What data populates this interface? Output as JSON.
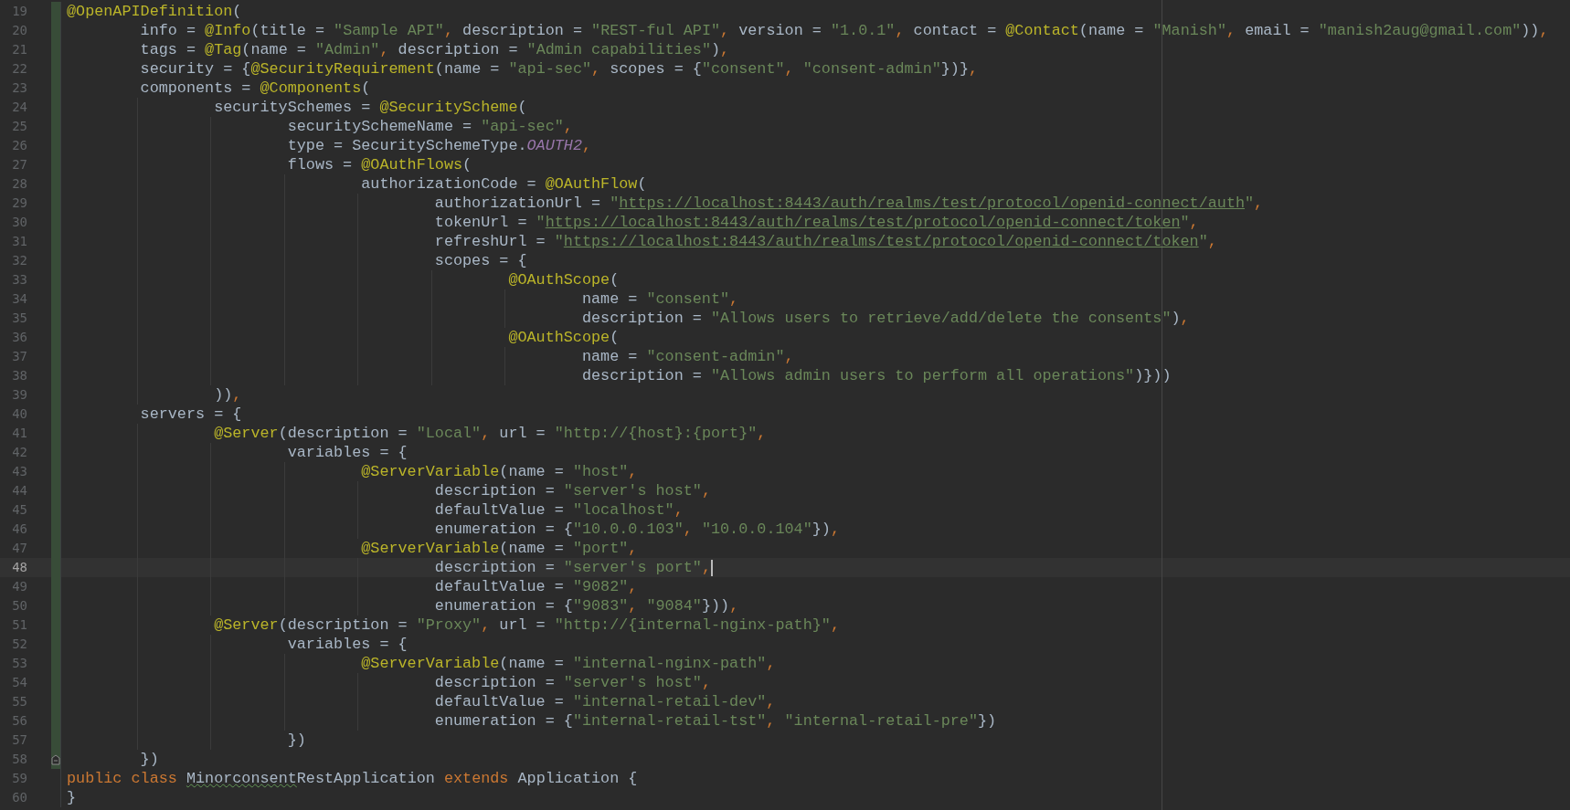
{
  "editor": {
    "lines": [
      {
        "number": "19",
        "changed": true,
        "current": false,
        "fold": false,
        "tokens": [
          {
            "kind": "annotation",
            "text": "@OpenAPIDefinition"
          },
          {
            "kind": "plain",
            "text": "("
          }
        ]
      },
      {
        "number": "20",
        "changed": true,
        "current": false,
        "fold": false,
        "tokens": [
          {
            "kind": "plain",
            "text": "        info = "
          },
          {
            "kind": "annotation",
            "text": "@Info"
          },
          {
            "kind": "plain",
            "text": "(title = "
          },
          {
            "kind": "string",
            "text": "\"Sample API\""
          },
          {
            "kind": "keyword",
            "text": ","
          },
          {
            "kind": "plain",
            "text": " description = "
          },
          {
            "kind": "string",
            "text": "\"REST-ful API\""
          },
          {
            "kind": "keyword",
            "text": ","
          },
          {
            "kind": "plain",
            "text": " version = "
          },
          {
            "kind": "string",
            "text": "\"1.0.1\""
          },
          {
            "kind": "keyword",
            "text": ","
          },
          {
            "kind": "plain",
            "text": " contact = "
          },
          {
            "kind": "annotation",
            "text": "@Contact"
          },
          {
            "kind": "plain",
            "text": "(name = "
          },
          {
            "kind": "string",
            "text": "\"Manish\""
          },
          {
            "kind": "keyword",
            "text": ","
          },
          {
            "kind": "plain",
            "text": " email = "
          },
          {
            "kind": "string",
            "text": "\"manish2aug@gmail.com\""
          },
          {
            "kind": "plain",
            "text": "))"
          },
          {
            "kind": "keyword",
            "text": ","
          }
        ]
      },
      {
        "number": "21",
        "changed": true,
        "current": false,
        "fold": false,
        "tokens": [
          {
            "kind": "plain",
            "text": "        tags = "
          },
          {
            "kind": "annotation",
            "text": "@Tag"
          },
          {
            "kind": "plain",
            "text": "(name = "
          },
          {
            "kind": "string",
            "text": "\"Admin\""
          },
          {
            "kind": "keyword",
            "text": ","
          },
          {
            "kind": "plain",
            "text": " description = "
          },
          {
            "kind": "string",
            "text": "\"Admin capabilities\""
          },
          {
            "kind": "plain",
            "text": ")"
          },
          {
            "kind": "keyword",
            "text": ","
          }
        ]
      },
      {
        "number": "22",
        "changed": true,
        "current": false,
        "fold": false,
        "tokens": [
          {
            "kind": "plain",
            "text": "        security = {"
          },
          {
            "kind": "annotation",
            "text": "@SecurityRequirement"
          },
          {
            "kind": "plain",
            "text": "(name = "
          },
          {
            "kind": "string",
            "text": "\"api-sec\""
          },
          {
            "kind": "keyword",
            "text": ","
          },
          {
            "kind": "plain",
            "text": " scopes = {"
          },
          {
            "kind": "string",
            "text": "\"consent\""
          },
          {
            "kind": "keyword",
            "text": ", "
          },
          {
            "kind": "string",
            "text": "\"consent-admin\""
          },
          {
            "kind": "plain",
            "text": "})}"
          },
          {
            "kind": "keyword",
            "text": ","
          }
        ]
      },
      {
        "number": "23",
        "changed": true,
        "current": false,
        "fold": false,
        "tokens": [
          {
            "kind": "plain",
            "text": "        components = "
          },
          {
            "kind": "annotation",
            "text": "@Components"
          },
          {
            "kind": "plain",
            "text": "("
          }
        ]
      },
      {
        "number": "24",
        "changed": true,
        "current": false,
        "fold": false,
        "tokens": [
          {
            "kind": "plain",
            "text": "                securitySchemes = "
          },
          {
            "kind": "annotation",
            "text": "@SecurityScheme"
          },
          {
            "kind": "plain",
            "text": "("
          }
        ]
      },
      {
        "number": "25",
        "changed": true,
        "current": false,
        "fold": false,
        "tokens": [
          {
            "kind": "plain",
            "text": "                        securitySchemeName = "
          },
          {
            "kind": "string",
            "text": "\"api-sec\""
          },
          {
            "kind": "keyword",
            "text": ","
          }
        ]
      },
      {
        "number": "26",
        "changed": true,
        "current": false,
        "fold": false,
        "tokens": [
          {
            "kind": "plain",
            "text": "                        type = SecuritySchemeType."
          },
          {
            "kind": "constant",
            "text": "OAUTH2"
          },
          {
            "kind": "keyword",
            "text": ","
          }
        ]
      },
      {
        "number": "27",
        "changed": true,
        "current": false,
        "fold": false,
        "tokens": [
          {
            "kind": "plain",
            "text": "                        flows = "
          },
          {
            "kind": "annotation",
            "text": "@OAuthFlows"
          },
          {
            "kind": "plain",
            "text": "("
          }
        ]
      },
      {
        "number": "28",
        "changed": true,
        "current": false,
        "fold": false,
        "tokens": [
          {
            "kind": "plain",
            "text": "                                authorizationCode = "
          },
          {
            "kind": "annotation",
            "text": "@OAuthFlow"
          },
          {
            "kind": "plain",
            "text": "("
          }
        ]
      },
      {
        "number": "29",
        "changed": true,
        "current": false,
        "fold": false,
        "tokens": [
          {
            "kind": "plain",
            "text": "                                        authorizationUrl = "
          },
          {
            "kind": "string",
            "text": "\""
          },
          {
            "kind": "url",
            "text": "https://localhost:8443/auth/realms/test/protocol/openid-connect/auth"
          },
          {
            "kind": "string",
            "text": "\""
          },
          {
            "kind": "keyword",
            "text": ","
          }
        ]
      },
      {
        "number": "30",
        "changed": true,
        "current": false,
        "fold": false,
        "tokens": [
          {
            "kind": "plain",
            "text": "                                        tokenUrl = "
          },
          {
            "kind": "string",
            "text": "\""
          },
          {
            "kind": "url",
            "text": "https://localhost:8443/auth/realms/test/protocol/openid-connect/token"
          },
          {
            "kind": "string",
            "text": "\""
          },
          {
            "kind": "keyword",
            "text": ","
          }
        ]
      },
      {
        "number": "31",
        "changed": true,
        "current": false,
        "fold": false,
        "tokens": [
          {
            "kind": "plain",
            "text": "                                        refreshUrl = "
          },
          {
            "kind": "string",
            "text": "\""
          },
          {
            "kind": "url",
            "text": "https://localhost:8443/auth/realms/test/protocol/openid-connect/token"
          },
          {
            "kind": "string",
            "text": "\""
          },
          {
            "kind": "keyword",
            "text": ","
          }
        ]
      },
      {
        "number": "32",
        "changed": true,
        "current": false,
        "fold": false,
        "tokens": [
          {
            "kind": "plain",
            "text": "                                        scopes = {"
          }
        ]
      },
      {
        "number": "33",
        "changed": true,
        "current": false,
        "fold": false,
        "tokens": [
          {
            "kind": "annotation",
            "text": "                                                @OAuthScope"
          },
          {
            "kind": "plain",
            "text": "("
          }
        ]
      },
      {
        "number": "34",
        "changed": true,
        "current": false,
        "fold": false,
        "tokens": [
          {
            "kind": "plain",
            "text": "                                                        name = "
          },
          {
            "kind": "string",
            "text": "\"consent\""
          },
          {
            "kind": "keyword",
            "text": ","
          }
        ]
      },
      {
        "number": "35",
        "changed": true,
        "current": false,
        "fold": false,
        "tokens": [
          {
            "kind": "plain",
            "text": "                                                        description = "
          },
          {
            "kind": "string",
            "text": "\"Allows users to retrieve/add/delete the consents\""
          },
          {
            "kind": "plain",
            "text": ")"
          },
          {
            "kind": "keyword",
            "text": ","
          }
        ]
      },
      {
        "number": "36",
        "changed": true,
        "current": false,
        "fold": false,
        "tokens": [
          {
            "kind": "annotation",
            "text": "                                                @OAuthScope"
          },
          {
            "kind": "plain",
            "text": "("
          }
        ]
      },
      {
        "number": "37",
        "changed": true,
        "current": false,
        "fold": false,
        "tokens": [
          {
            "kind": "plain",
            "text": "                                                        name = "
          },
          {
            "kind": "string",
            "text": "\"consent-admin\""
          },
          {
            "kind": "keyword",
            "text": ","
          }
        ]
      },
      {
        "number": "38",
        "changed": true,
        "current": false,
        "fold": false,
        "tokens": [
          {
            "kind": "plain",
            "text": "                                                        description = "
          },
          {
            "kind": "string",
            "text": "\"Allows admin users to perform all operations\""
          },
          {
            "kind": "plain",
            "text": ")}))"
          }
        ]
      },
      {
        "number": "39",
        "changed": true,
        "current": false,
        "fold": false,
        "tokens": [
          {
            "kind": "plain",
            "text": "                ))"
          },
          {
            "kind": "keyword",
            "text": ","
          }
        ]
      },
      {
        "number": "40",
        "changed": true,
        "current": false,
        "fold": false,
        "tokens": [
          {
            "kind": "plain",
            "text": "        servers = {"
          }
        ]
      },
      {
        "number": "41",
        "changed": true,
        "current": false,
        "fold": false,
        "tokens": [
          {
            "kind": "annotation",
            "text": "                @Server"
          },
          {
            "kind": "plain",
            "text": "(description = "
          },
          {
            "kind": "string",
            "text": "\"Local\""
          },
          {
            "kind": "keyword",
            "text": ","
          },
          {
            "kind": "plain",
            "text": " url = "
          },
          {
            "kind": "string",
            "text": "\"http://{host}:{port}\""
          },
          {
            "kind": "keyword",
            "text": ","
          }
        ]
      },
      {
        "number": "42",
        "changed": true,
        "current": false,
        "fold": false,
        "tokens": [
          {
            "kind": "plain",
            "text": "                        variables = {"
          }
        ]
      },
      {
        "number": "43",
        "changed": true,
        "current": false,
        "fold": false,
        "tokens": [
          {
            "kind": "annotation",
            "text": "                                @ServerVariable"
          },
          {
            "kind": "plain",
            "text": "(name = "
          },
          {
            "kind": "string",
            "text": "\"host\""
          },
          {
            "kind": "keyword",
            "text": ","
          }
        ]
      },
      {
        "number": "44",
        "changed": true,
        "current": false,
        "fold": false,
        "tokens": [
          {
            "kind": "plain",
            "text": "                                        description = "
          },
          {
            "kind": "string",
            "text": "\"server's host\""
          },
          {
            "kind": "keyword",
            "text": ","
          }
        ]
      },
      {
        "number": "45",
        "changed": true,
        "current": false,
        "fold": false,
        "tokens": [
          {
            "kind": "plain",
            "text": "                                        defaultValue = "
          },
          {
            "kind": "string",
            "text": "\"localhost\""
          },
          {
            "kind": "keyword",
            "text": ","
          }
        ]
      },
      {
        "number": "46",
        "changed": true,
        "current": false,
        "fold": false,
        "tokens": [
          {
            "kind": "plain",
            "text": "                                        enumeration = {"
          },
          {
            "kind": "string",
            "text": "\"10.0.0.103\""
          },
          {
            "kind": "keyword",
            "text": ", "
          },
          {
            "kind": "string",
            "text": "\"10.0.0.104\""
          },
          {
            "kind": "plain",
            "text": "})"
          },
          {
            "kind": "keyword",
            "text": ","
          }
        ]
      },
      {
        "number": "47",
        "changed": true,
        "current": false,
        "fold": false,
        "tokens": [
          {
            "kind": "annotation",
            "text": "                                @ServerVariable"
          },
          {
            "kind": "plain",
            "text": "(name = "
          },
          {
            "kind": "string",
            "text": "\"port\""
          },
          {
            "kind": "keyword",
            "text": ","
          }
        ]
      },
      {
        "number": "48",
        "changed": true,
        "current": true,
        "fold": false,
        "tokens": [
          {
            "kind": "plain",
            "text": "                                        description = "
          },
          {
            "kind": "string",
            "text": "\"server's port\""
          },
          {
            "kind": "keyword",
            "text": ","
          }
        ]
      },
      {
        "number": "49",
        "changed": true,
        "current": false,
        "fold": false,
        "tokens": [
          {
            "kind": "plain",
            "text": "                                        defaultValue = "
          },
          {
            "kind": "string",
            "text": "\"9082\""
          },
          {
            "kind": "keyword",
            "text": ","
          }
        ]
      },
      {
        "number": "50",
        "changed": true,
        "current": false,
        "fold": false,
        "tokens": [
          {
            "kind": "plain",
            "text": "                                        enumeration = {"
          },
          {
            "kind": "string",
            "text": "\"9083\""
          },
          {
            "kind": "keyword",
            "text": ", "
          },
          {
            "kind": "string",
            "text": "\"9084\""
          },
          {
            "kind": "plain",
            "text": "}))"
          },
          {
            "kind": "keyword",
            "text": ","
          }
        ]
      },
      {
        "number": "51",
        "changed": true,
        "current": false,
        "fold": false,
        "tokens": [
          {
            "kind": "annotation",
            "text": "                @Server"
          },
          {
            "kind": "plain",
            "text": "(description = "
          },
          {
            "kind": "string",
            "text": "\"Proxy\""
          },
          {
            "kind": "keyword",
            "text": ","
          },
          {
            "kind": "plain",
            "text": " url = "
          },
          {
            "kind": "string",
            "text": "\"http://{internal-nginx-path}\""
          },
          {
            "kind": "keyword",
            "text": ","
          }
        ]
      },
      {
        "number": "52",
        "changed": true,
        "current": false,
        "fold": false,
        "tokens": [
          {
            "kind": "plain",
            "text": "                        variables = {"
          }
        ]
      },
      {
        "number": "53",
        "changed": true,
        "current": false,
        "fold": false,
        "tokens": [
          {
            "kind": "annotation",
            "text": "                                @ServerVariable"
          },
          {
            "kind": "plain",
            "text": "(name = "
          },
          {
            "kind": "string",
            "text": "\"internal-nginx-path\""
          },
          {
            "kind": "keyword",
            "text": ","
          }
        ]
      },
      {
        "number": "54",
        "changed": true,
        "current": false,
        "fold": false,
        "tokens": [
          {
            "kind": "plain",
            "text": "                                        description = "
          },
          {
            "kind": "string",
            "text": "\"server's host\""
          },
          {
            "kind": "keyword",
            "text": ","
          }
        ]
      },
      {
        "number": "55",
        "changed": true,
        "current": false,
        "fold": false,
        "tokens": [
          {
            "kind": "plain",
            "text": "                                        defaultValue = "
          },
          {
            "kind": "string",
            "text": "\"internal-retail-dev\""
          },
          {
            "kind": "keyword",
            "text": ","
          }
        ]
      },
      {
        "number": "56",
        "changed": true,
        "current": false,
        "fold": false,
        "tokens": [
          {
            "kind": "plain",
            "text": "                                        enumeration = {"
          },
          {
            "kind": "string",
            "text": "\"internal-retail-tst\""
          },
          {
            "kind": "keyword",
            "text": ", "
          },
          {
            "kind": "string",
            "text": "\"internal-retail-pre\""
          },
          {
            "kind": "plain",
            "text": "})"
          }
        ]
      },
      {
        "number": "57",
        "changed": true,
        "current": false,
        "fold": false,
        "tokens": [
          {
            "kind": "plain",
            "text": "                        })"
          }
        ]
      },
      {
        "number": "58",
        "changed": true,
        "current": false,
        "fold": true,
        "tokens": [
          {
            "kind": "plain",
            "text": "        })"
          }
        ]
      },
      {
        "number": "59",
        "changed": false,
        "current": false,
        "fold": false,
        "tokens": [
          {
            "kind": "keyword",
            "text": "public class "
          },
          {
            "kind": "warning",
            "text": "Minorconsent"
          },
          {
            "kind": "plain",
            "text": "RestApplication"
          },
          {
            "kind": "keyword",
            "text": " extends "
          },
          {
            "kind": "plain",
            "text": "Application {"
          }
        ]
      },
      {
        "number": "60",
        "changed": false,
        "current": false,
        "fold": false,
        "tokens": [
          {
            "kind": "plain",
            "text": "}"
          }
        ]
      }
    ]
  }
}
